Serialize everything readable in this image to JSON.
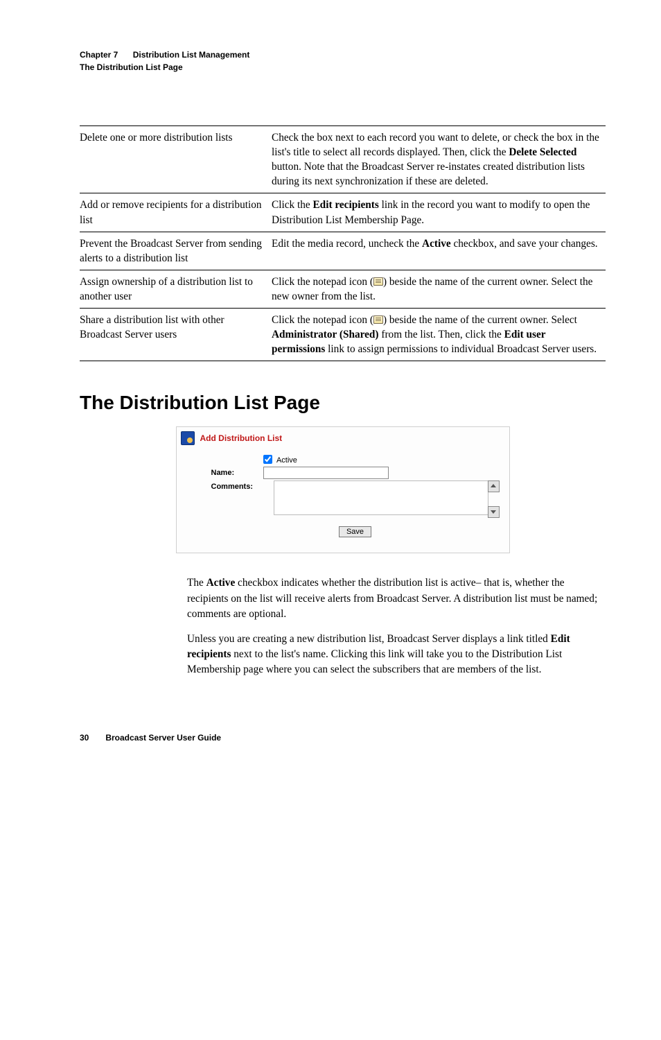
{
  "header": {
    "chapter_label": "Chapter 7",
    "chapter_title": "Distribution List Management",
    "section_title": "The Distribution List Page"
  },
  "table": {
    "rows": [
      {
        "task": "Delete one or more distribution lists",
        "instr_parts": [
          "Check the box next to each record you want to delete, or check the box in the list's title to select all records displayed. Then, click the ",
          "Delete Selected",
          " button. Note that the Broadcast Server re-instates created distribution lists during its next synchronization if these are deleted."
        ]
      },
      {
        "task": "Add or remove recipients for a distribution list",
        "instr_parts": [
          "Click the ",
          "Edit recipients",
          " link in the record you want to modify to open the Distribution List Membership Page."
        ]
      },
      {
        "task": "Prevent the Broadcast Server from sending alerts to a distribution list",
        "instr_parts": [
          "Edit the media record, uncheck the ",
          "Active",
          " checkbox, and save your changes."
        ]
      },
      {
        "task": "Assign ownership of a distribution list to another user",
        "instr_parts": [
          "Click the notepad icon (",
          "ICON",
          ") beside the name of the current owner. Select the new owner from the list."
        ]
      },
      {
        "task": "Share a distribution list with other Broadcast Server users",
        "instr_parts": [
          "Click the notepad icon (",
          "ICON",
          ") beside the name of the current owner. Select ",
          "Administrator (Shared)",
          " from the list. Then, click the ",
          "Edit user permissions",
          " link to assign permissions to individual Broadcast Server users."
        ]
      }
    ]
  },
  "section_heading": "The Distribution List Page",
  "figure": {
    "title": "Add Distribution List",
    "active_label": "Active",
    "name_label": "Name:",
    "comments_label": "Comments:",
    "save_label": "Save",
    "name_value": "",
    "comments_value": ""
  },
  "body": {
    "p1_parts": [
      "The ",
      "Active",
      " checkbox indicates whether the distribution list is active– that is, whether the recipients on the list will receive alerts from Broadcast Server. A distribution list must be named; comments are optional."
    ],
    "p2_parts": [
      "Unless you are creating a new distribution list, Broadcast Server displays a link titled ",
      "Edit recipients",
      " next to the list's name. Clicking this link will take you to the Distribution List Membership page where you can select the subscribers that are members of the list."
    ]
  },
  "footer": {
    "page": "30",
    "doc_title": "Broadcast Server User Guide"
  }
}
